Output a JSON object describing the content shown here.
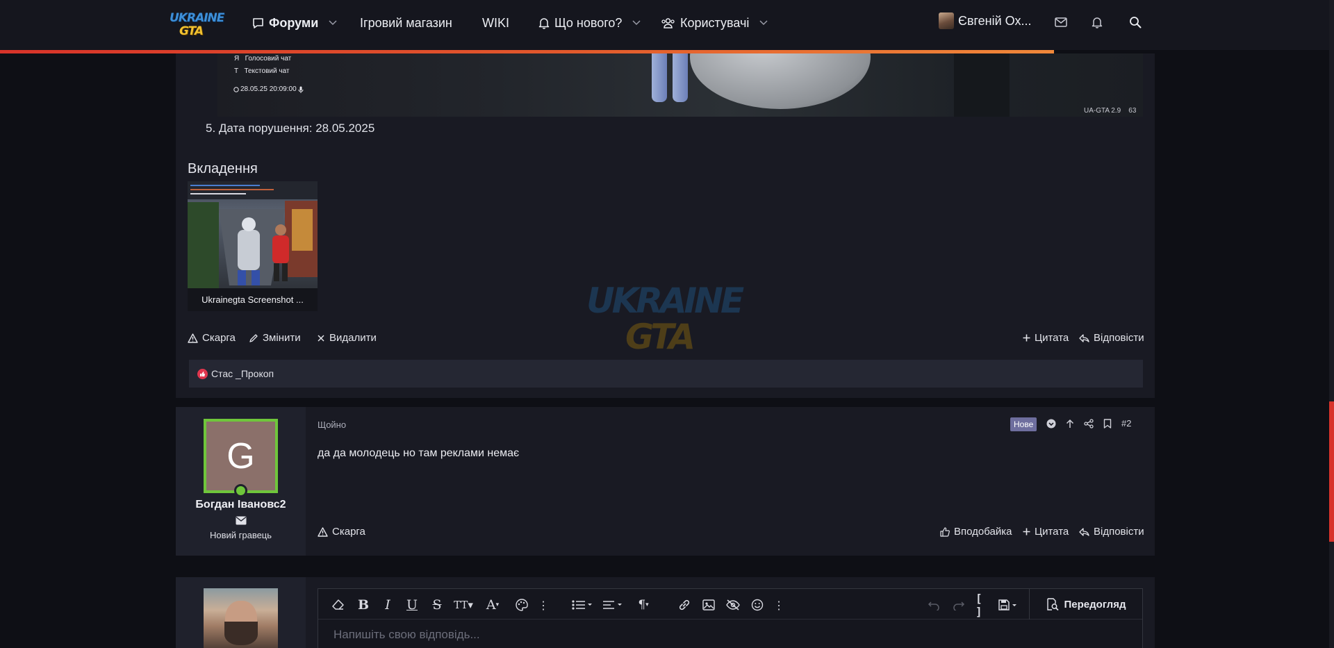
{
  "nav": {
    "forums": "Форуми",
    "shop": "Ігровий магазин",
    "wiki": "WIKI",
    "whats_new": "Що нового?",
    "users": "Користувачі",
    "account_name": "Євгеній Ох..."
  },
  "logo": {
    "line1": "UKRAINE",
    "line2": "GTA"
  },
  "screenshot_hud": {
    "voice_key": "Я",
    "voice_label": "Голосовий чат",
    "text_key": "Т",
    "text_label": "Текстовий чат",
    "datetime": "28.05.25 20:09:00",
    "version": "UA-GTA 2.9",
    "version_extra": "63"
  },
  "post1": {
    "violation_date": "5. Дата порушення: 28.05.2025",
    "attachments_heading": "Вкладення",
    "attachment_caption": "Ukrainegta Screenshot ...",
    "actions": {
      "report": "Скарга",
      "edit": "Змінити",
      "delete": "Видалити",
      "quote": "Цитата",
      "reply": "Відповісти"
    },
    "liked_by": "Стас _Прокоп"
  },
  "post2": {
    "avatar_letter": "G",
    "username": "Богдан Івановс2",
    "user_title": "Новий гравець",
    "time": "Щойно",
    "badge": "Нове",
    "post_number": "#2",
    "text": "да да молодець но там реклами немає",
    "actions": {
      "report": "Скарга",
      "like": "Вподобайка",
      "quote": "Цитата",
      "reply": "Відповісти"
    }
  },
  "editor": {
    "placeholder": "Напишіть свою відповідь...",
    "preview": "Передогляд"
  },
  "colors": {
    "accent": "#d8332a",
    "online": "#6fc63b",
    "background": "#0e0f15",
    "panel": "#191a23"
  },
  "scroll_position": 0.71
}
